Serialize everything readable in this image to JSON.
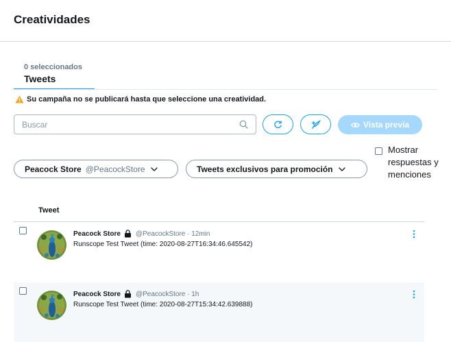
{
  "page": {
    "title": "Creatividades"
  },
  "tab": {
    "count_label": "0 seleccionados",
    "label": "Tweets"
  },
  "warning": {
    "text": "Su campaña no se publicará hasta que seleccione una creatividad.",
    "icon": "warning-triangle-icon",
    "color": "#f5a623"
  },
  "search": {
    "placeholder": "Buscar",
    "value": ""
  },
  "toolbar": {
    "refresh_icon": "refresh-icon",
    "compose_icon": "compose-icon",
    "preview_label": "Vista previa"
  },
  "filters": {
    "store_name": "Peacock Store",
    "store_handle": "@PeacockStore",
    "type_label": "Tweets exclusivos para promoción"
  },
  "show_replies": {
    "label": "Mostrar respuestas y menciones",
    "checked": false
  },
  "table": {
    "column_header": "Tweet",
    "rows": [
      {
        "name": "Peacock Store",
        "handle_time": "@PeacockStore · 12min",
        "text": "Runscope Test Tweet (time: 2020-08-27T16:34:46.645542)",
        "checked": false
      },
      {
        "name": "Peacock Store",
        "handle_time": "@PeacockStore · 1h",
        "text": "Runscope Test Tweet (time: 2020-08-27T15:34:42.639888)",
        "checked": false
      }
    ]
  },
  "colors": {
    "accent": "#1da1f2",
    "preview_disabled": "#a5d8fa",
    "alt_row": "#f5f8fa"
  }
}
